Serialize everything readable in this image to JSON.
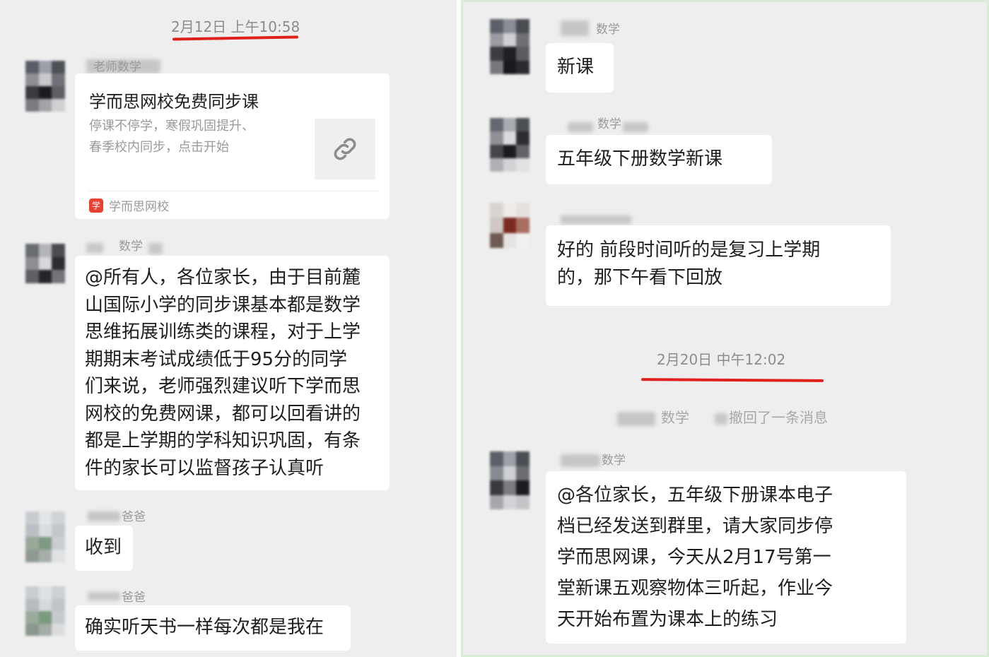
{
  "left_panel": {
    "timestamp": "2月12日 上午10:58",
    "messages": [
      {
        "sender": "老师数学",
        "type": "link_card",
        "card_title": "学而思网校免费同步课",
        "card_desc_lines": [
          "停课不停学，寒假巩固提升、",
          "春季校内同步，点击开始"
        ],
        "card_source": "学而思网校",
        "card_source_icon": "学",
        "thumb_icon": "link-icon"
      },
      {
        "sender": "数学",
        "type": "text",
        "lines": [
          "@所有人，各位家长，由于目前麓",
          "山国际小学的同步课基本都是数学",
          "思维拓展训练类的课程，对于上学",
          "期期末考试成绩低于95分的同学",
          "们来说，老师强烈建议听下学而思",
          "网校的免费网课，都可以回看讲的",
          "都是上学期的学科知识巩固，有条",
          "件的家长可以监督孩子认真听"
        ]
      },
      {
        "sender": "爸爸",
        "type": "text",
        "lines": [
          "收到"
        ]
      },
      {
        "sender": "爸爸",
        "type": "text",
        "lines": [
          "确实听天书一样每次都是我在"
        ]
      }
    ]
  },
  "right_panel": {
    "messages_before": [
      {
        "sender": "数学",
        "lines": [
          "新课"
        ]
      },
      {
        "sender": "数学",
        "lines": [
          "五年级下册数学新课"
        ]
      },
      {
        "sender": "",
        "lines": [
          "好的 前段时间听的是复习上学期",
          "的，那下午看下回放"
        ]
      }
    ],
    "timestamp": "2月20日 中午12:02",
    "system_notice": {
      "sender": "数学",
      "text": "撤回了一条消息"
    },
    "messages_after": [
      {
        "sender": "数学",
        "lines": [
          "@各位家长，五年级下册课本电子",
          "档已经发送到群里，请大家同步停",
          "学而思网课，今天从2月17号第一",
          "堂新课五观察物体三听起，作业今",
          "天开始布置为课本上的练习"
        ]
      }
    ]
  },
  "colors": {
    "chat_background": "#eeeeee",
    "bubble": "#ffffff",
    "timestamp_underline": "#e0201d",
    "card_source_icon": "#e84132"
  }
}
